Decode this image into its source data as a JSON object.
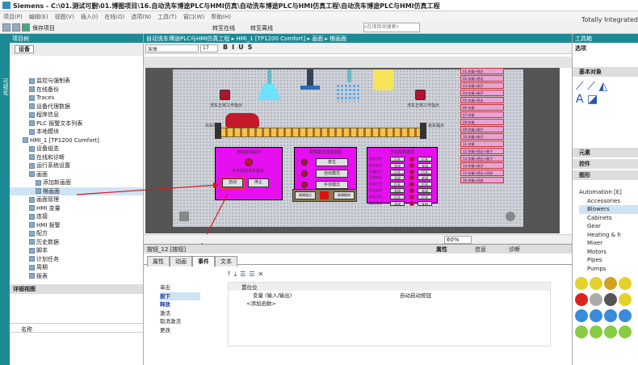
{
  "window": {
    "title": "Siemens - C:\\01.测试可删\\01.博图项目\\16.自动洗车博途PLC与HMI仿真\\自动洗车博途PLC与HMI仿真工程\\自动洗车博途PLC与HMI仿真工程",
    "brand": "Totally Integrated"
  },
  "menu": [
    "项目(P)",
    "编辑(E)",
    "视图(V)",
    "插入(I)",
    "在线(O)",
    "选项(N)",
    "工具(T)",
    "窗口(W)",
    "帮助(H)"
  ],
  "toolbar": {
    "save_label": "保存项目",
    "go_online": "转至在线",
    "go_offline": "转至离线",
    "search_placeholder": "<在项目中搜索>"
  },
  "side_tabs": [
    "可视化"
  ],
  "project_tree": {
    "header": "项目树",
    "tab": "设备",
    "items": [
      {
        "label": "监控与强制表",
        "indent": 3
      },
      {
        "label": "在线备份",
        "indent": 3
      },
      {
        "label": "Traces",
        "indent": 3
      },
      {
        "label": "设备代理数据",
        "indent": 3
      },
      {
        "label": "程序信息",
        "indent": 3
      },
      {
        "label": "PLC 报警文本列表",
        "indent": 3
      },
      {
        "label": "本地模块",
        "indent": 3
      },
      {
        "label": "HMI_1 [TP1200 Comfort]",
        "indent": 2
      },
      {
        "label": "设备组态",
        "indent": 3
      },
      {
        "label": "在线和诊断",
        "indent": 3
      },
      {
        "label": "运行系统设置",
        "indent": 3
      },
      {
        "label": "画面",
        "indent": 3
      },
      {
        "label": "添加新画面",
        "indent": 4
      },
      {
        "label": "根画面",
        "indent": 4,
        "selected": true
      },
      {
        "label": "画面管理",
        "indent": 3
      },
      {
        "label": "HMI 变量",
        "indent": 3
      },
      {
        "label": "连接",
        "indent": 3
      },
      {
        "label": "HMI 报警",
        "indent": 3
      },
      {
        "label": "配方",
        "indent": 3
      },
      {
        "label": "历史数据",
        "indent": 3
      },
      {
        "label": "脚本",
        "indent": 3
      },
      {
        "label": "计划任务",
        "indent": 3
      },
      {
        "label": "周期",
        "indent": 3
      },
      {
        "label": "报表",
        "indent": 3
      }
    ]
  },
  "details": {
    "header": "详细视图",
    "column": "名称"
  },
  "editor": {
    "breadcrumb": "自动洗车博途PLC与HMI仿真工程 ▸ HMI_1 [TP1200 Comfort] ▸ 画面 ▸ 根画面",
    "font_name": "宋体",
    "font_size": "17",
    "zoom": "60%"
  },
  "hmi": {
    "left_station": "洗车正常工作指示",
    "right_station": "洗车正常工作指示",
    "leave": "出车指示",
    "enter": "进车指示",
    "panel1_title": "自动启动指示",
    "panel1_lamp": "允许自动洗车指示",
    "auto_start": "自动",
    "stop": "停止",
    "panel2_title": "故障模式选择按钮",
    "reset": "复位",
    "auto_mode": "自动模式",
    "manual_mode": "手动模式",
    "fault_reset": "故障复位",
    "fault_release": "故障解除",
    "panel3_title": "手动控制按钮",
    "manual_rows": [
      "洗车打开",
      "洗车关闭",
      "打蜡打开",
      "打蜡关闭",
      "风机打开",
      "风机关闭",
      "清洗打开",
      "清洗关闭"
    ],
    "on": "打开",
    "off": "关闭",
    "status": [
      "01:车辆+喷水",
      "02:车辆+喷水",
      "03:车辆+刷子",
      "04:车辆+刷子",
      "05:车辆+喷水",
      "06:车辆",
      "07:车辆",
      "08:车辆",
      "09:车辆+刷子",
      "10:车辆+刷子",
      "11:车辆",
      "12:车辆+喷水+刷子",
      "13:车辆+喷水+刷子",
      "14:车辆+刷子",
      "15:车辆+喷水+风机",
      "16:车辆+风机"
    ]
  },
  "inspector": {
    "object": "按钮_12 [按钮]",
    "tabs": [
      "属性",
      "动画",
      "事件",
      "文本"
    ],
    "right_tabs": [
      "属性",
      "信息",
      "诊断"
    ],
    "events": [
      "单击",
      "按下",
      "释放",
      "激活",
      "取消激活",
      "更改"
    ],
    "fn_header": "置位位",
    "fn_row": "变量 (输入/输出)",
    "fn_value": "自动启动按钮",
    "fn_add": "<添加函数>"
  },
  "toolbox": {
    "header": "工具箱",
    "options": "选项",
    "basic": "基本对象",
    "elements": "元素",
    "controls": "控件",
    "graphics": "图形",
    "graphics_items": [
      "Automation [E]",
      "Accessories",
      "Blowers",
      "Cabinets",
      "Gear",
      "Heating & h",
      "Mixer",
      "Motors",
      "Pipes",
      "Pumps"
    ]
  },
  "colors": {
    "accent": "#1c8a95",
    "magenta": "#e60ff0",
    "arrow": "#d61a1a"
  }
}
